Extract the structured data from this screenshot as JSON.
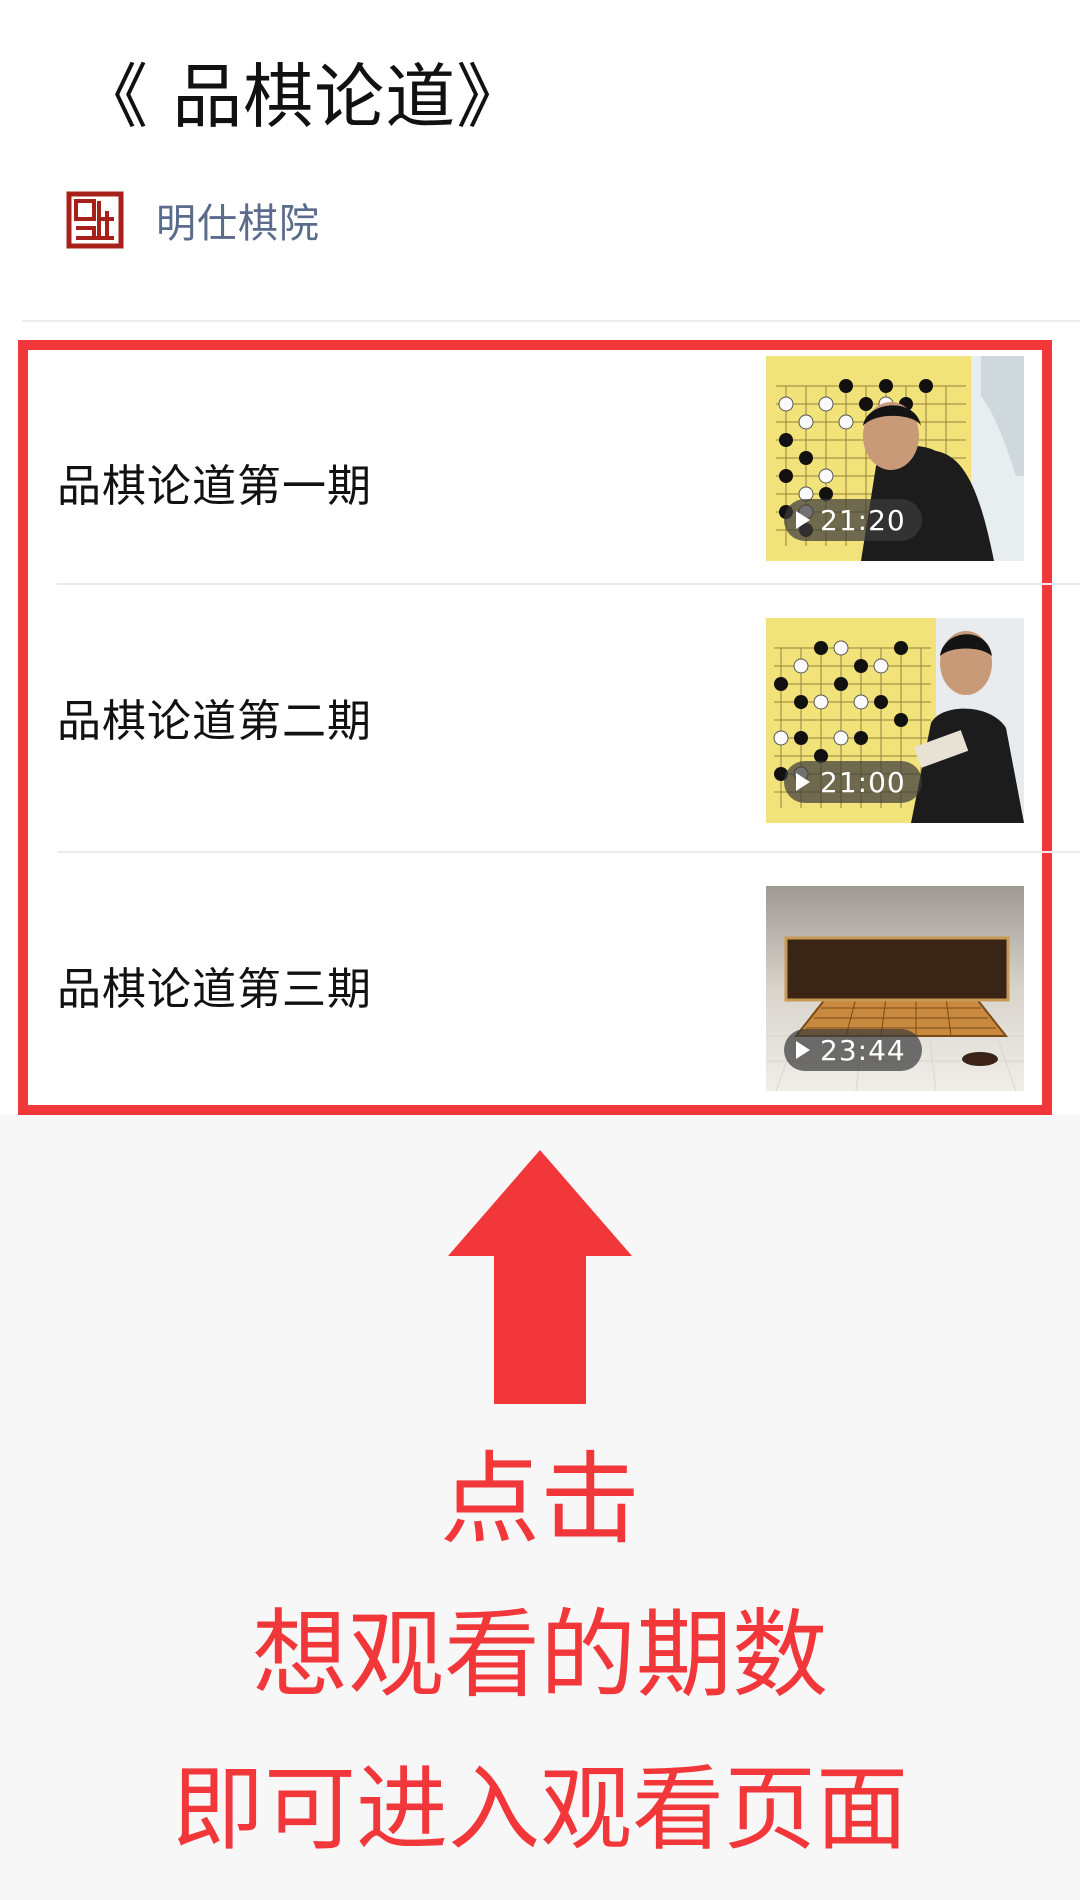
{
  "article": {
    "title": "《 品棋论道》",
    "account_name": "明仕棋院",
    "account_logo_icon": "seal-logo-icon"
  },
  "videos": [
    {
      "title": "品棋论道第一期",
      "duration": "21:20",
      "thumbnail": "go-board-commentator-thumbnail"
    },
    {
      "title": "品棋论道第二期",
      "duration": "21:00",
      "thumbnail": "go-board-commentator-thumbnail"
    },
    {
      "title": "品棋论道第三期",
      "duration": "23:44",
      "thumbnail": "program-logo-thumbnail"
    }
  ],
  "annotation": {
    "arrow_icon": "up-arrow-icon",
    "line1": "点击",
    "line2": "想观看的期数",
    "line3": "即可进入观看页面"
  },
  "colors": {
    "highlight_red": "#f2373a",
    "account_name": "#5b6b8c",
    "logo_red": "#a8201a"
  }
}
